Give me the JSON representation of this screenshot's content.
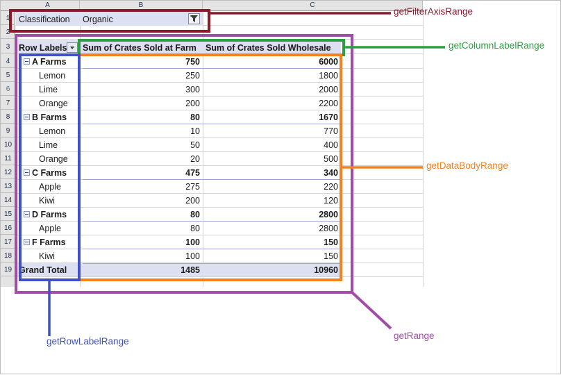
{
  "sheet": {
    "column_headers": [
      "A",
      "B",
      "C"
    ],
    "row_numbers": [
      "1",
      "2",
      "3",
      "4",
      "5",
      "6",
      "7",
      "8",
      "9",
      "10",
      "11",
      "12",
      "13",
      "14",
      "15",
      "16",
      "17",
      "18",
      "19"
    ]
  },
  "filter": {
    "label": "Classification",
    "value": "Organic",
    "button_icon": "filter-icon"
  },
  "pivot": {
    "row_label_header": "Row Labels",
    "row_label_dropdown_icon": "chevron-down-icon",
    "column_headers": [
      "Sum of Crates Sold at Farm",
      "Sum of Crates Sold Wholesale"
    ],
    "rows": [
      {
        "label": "A Farms",
        "group": true,
        "farm": "750",
        "wholesale": "6000"
      },
      {
        "label": "Lemon",
        "group": false,
        "farm": "250",
        "wholesale": "1800"
      },
      {
        "label": "Lime",
        "group": false,
        "farm": "300",
        "wholesale": "2000"
      },
      {
        "label": "Orange",
        "group": false,
        "farm": "200",
        "wholesale": "2200"
      },
      {
        "label": "B Farms",
        "group": true,
        "farm": "80",
        "wholesale": "1670"
      },
      {
        "label": "Lemon",
        "group": false,
        "farm": "10",
        "wholesale": "770"
      },
      {
        "label": "Lime",
        "group": false,
        "farm": "50",
        "wholesale": "400"
      },
      {
        "label": "Orange",
        "group": false,
        "farm": "20",
        "wholesale": "500"
      },
      {
        "label": "C Farms",
        "group": true,
        "farm": "475",
        "wholesale": "340"
      },
      {
        "label": "Apple",
        "group": false,
        "farm": "275",
        "wholesale": "220"
      },
      {
        "label": "Kiwi",
        "group": false,
        "farm": "200",
        "wholesale": "120"
      },
      {
        "label": "D Farms",
        "group": true,
        "farm": "80",
        "wholesale": "2800"
      },
      {
        "label": "Apple",
        "group": false,
        "farm": "80",
        "wholesale": "2800"
      },
      {
        "label": "F Farms",
        "group": true,
        "farm": "100",
        "wholesale": "150"
      },
      {
        "label": "Kiwi",
        "group": false,
        "farm": "100",
        "wholesale": "150"
      }
    ],
    "grand_total": {
      "label": "Grand Total",
      "farm": "1485",
      "wholesale": "10960"
    }
  },
  "annotations": [
    {
      "id": "filter-axis",
      "label": "getFilterAxisRange",
      "color": "#8B1A2B"
    },
    {
      "id": "column-label",
      "label": "getColumnLabelRange",
      "color": "#2E9E43"
    },
    {
      "id": "data-body",
      "label": "getDataBodyRange",
      "color": "#F58220"
    },
    {
      "id": "row-label",
      "label": "getRowLabelRange",
      "color": "#3F51C4"
    },
    {
      "id": "range",
      "label": "getRange",
      "color": "#A14CA8"
    }
  ]
}
